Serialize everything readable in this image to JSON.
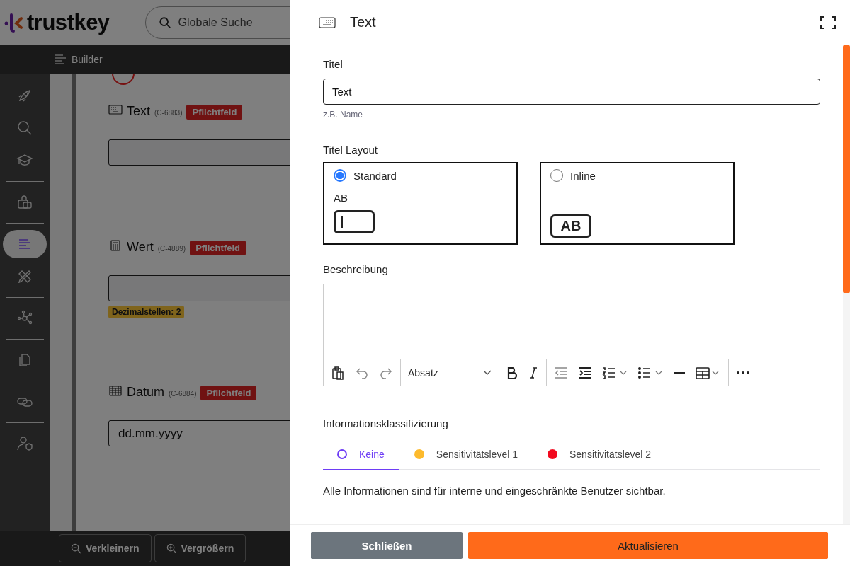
{
  "app": {
    "brand": "trustkey",
    "search": {
      "placeholder": "Globale Suche"
    },
    "toolbar": {
      "title": "Builder"
    },
    "sidebar": {
      "groups": [
        {
          "items": [
            {
              "selected": false
            },
            {
              "selected": false
            },
            {
              "selected": false
            }
          ]
        },
        {
          "items": [
            {
              "selected": false
            }
          ]
        },
        {
          "items": [
            {
              "selected": true
            },
            {
              "selected": false
            }
          ]
        },
        {
          "items": [
            {
              "selected": false
            }
          ]
        },
        {
          "items": [
            {
              "selected": false
            }
          ]
        },
        {
          "items": [
            {
              "selected": false
            }
          ]
        },
        {
          "items": [
            {
              "selected": false
            }
          ]
        }
      ]
    },
    "fields": [
      {
        "kind": "text",
        "label": "Text",
        "code": "(C-6883)",
        "badge": "Pflichtfeld"
      },
      {
        "kind": "number",
        "label": "Wert",
        "code": "(C-4889)",
        "badge": "Pflichtfeld",
        "tag": "Dezimalstellen: 2"
      },
      {
        "kind": "date",
        "label": "Datum",
        "code": "(C-6884)",
        "badge": "Pflichtfeld",
        "placeholder": "dd.mm.yyyy"
      }
    ],
    "zoom_buttons": [
      {
        "kind": "out",
        "label": "Verkleinern"
      },
      {
        "kind": "in",
        "label": "Vergrößern"
      }
    ]
  },
  "panel": {
    "title": "Text",
    "title_field": {
      "label": "Titel",
      "value": "Text",
      "hint": "z.B. Name"
    },
    "title_layout": {
      "label": "Titel Layout",
      "options": [
        {
          "kind": "stacked",
          "label": "Standard",
          "preview": "AB",
          "selected": true
        },
        {
          "kind": "inline",
          "label": "Inline",
          "preview": "AB",
          "selected": false
        }
      ]
    },
    "description": {
      "label": "Beschreibung",
      "format": "Absatz"
    },
    "classification": {
      "label": "Informationsklassifizierung",
      "tabs": [
        {
          "label": "Keine",
          "color": "#6e3df5",
          "selected": true
        },
        {
          "label": "Sensitivitätslevel 1",
          "color": "#fdba2c",
          "selected": false
        },
        {
          "label": "Sensitivitätslevel 2",
          "color": "#f2091e",
          "selected": false
        }
      ],
      "text": "Alle Informationen sind für interne und eingeschränkte Benutzer sichtbar."
    },
    "buttons": [
      {
        "kind": "secondary",
        "label": "Schließen"
      },
      {
        "kind": "primary",
        "label": "Aktualisieren"
      }
    ]
  }
}
